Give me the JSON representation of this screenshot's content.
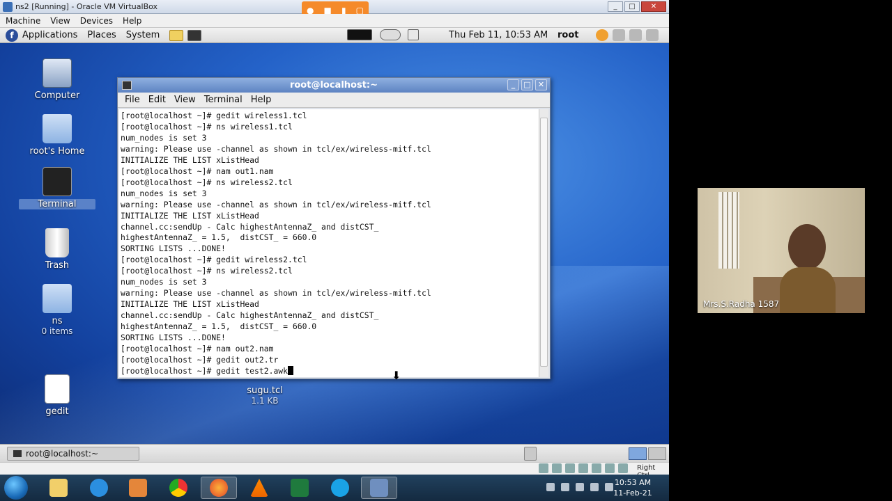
{
  "vbox": {
    "title": "ns2 [Running] - Oracle VM VirtualBox",
    "menu": [
      "Machine",
      "View",
      "Devices",
      "Help"
    ],
    "status_right": "Right Ctrl"
  },
  "gnome_panel": {
    "menus": [
      "Applications",
      "Places",
      "System"
    ],
    "clock": "Thu Feb 11, 10:53 AM",
    "user": "root"
  },
  "desktop_icons": [
    {
      "label": "Computer",
      "sub": ""
    },
    {
      "label": "root's Home",
      "sub": ""
    },
    {
      "label": "Terminal",
      "sub": ""
    },
    {
      "label": "Trash",
      "sub": ""
    },
    {
      "label": "ns",
      "sub": "0 items"
    },
    {
      "label": "gedit",
      "sub": ""
    },
    {
      "label": "sugu.tcl",
      "sub": "1.1 KB"
    }
  ],
  "terminal": {
    "title": "root@localhost:~",
    "menu": [
      "File",
      "Edit",
      "View",
      "Terminal",
      "Help"
    ],
    "lines": [
      "[root@localhost ~]# gedit wireless1.tcl",
      "[root@localhost ~]# ns wireless1.tcl",
      "num_nodes is set 3",
      "warning: Please use -channel as shown in tcl/ex/wireless-mitf.tcl",
      "INITIALIZE THE LIST xListHead",
      "[root@localhost ~]# nam out1.nam",
      "[root@localhost ~]# ns wireless2.tcl",
      "num_nodes is set 3",
      "warning: Please use -channel as shown in tcl/ex/wireless-mitf.tcl",
      "INITIALIZE THE LIST xListHead",
      "channel.cc:sendUp - Calc highestAntennaZ_ and distCST_",
      "highestAntennaZ_ = 1.5,  distCST_ = 660.0",
      "SORTING LISTS ...DONE!",
      "[root@localhost ~]# gedit wireless2.tcl",
      "[root@localhost ~]# ns wireless2.tcl",
      "num_nodes is set 3",
      "warning: Please use -channel as shown in tcl/ex/wireless-mitf.tcl",
      "INITIALIZE THE LIST xListHead",
      "channel.cc:sendUp - Calc highestAntennaZ_ and distCST_",
      "highestAntennaZ_ = 1.5,  distCST_ = 660.0",
      "SORTING LISTS ...DONE!",
      "[root@localhost ~]# nam out2.nam",
      "[root@localhost ~]# gedit out2.tr",
      "[root@localhost ~]# gedit test2.awk"
    ]
  },
  "bottom_panel": {
    "task_label": "root@localhost:~"
  },
  "windows_taskbar": {
    "time": "10:53 AM",
    "date": "11-Feb-21"
  },
  "webcam": {
    "name": "Mrs.S.Radha 1587"
  }
}
